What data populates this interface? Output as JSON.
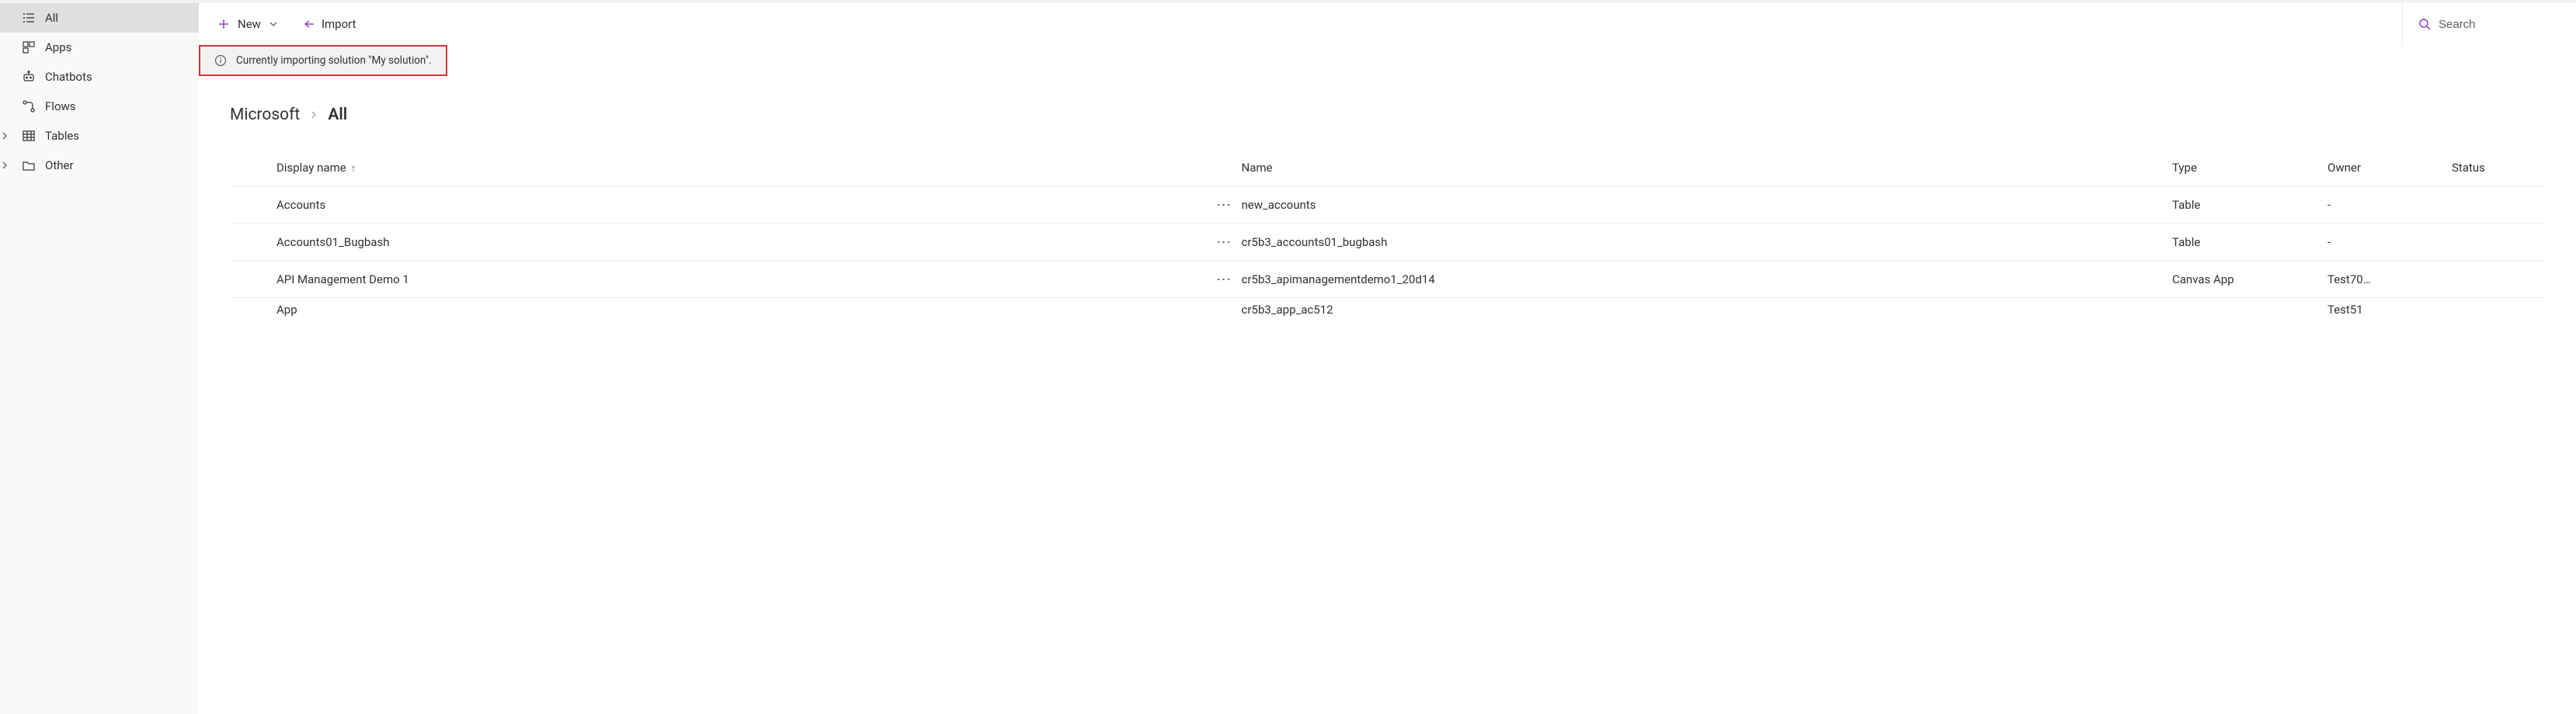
{
  "accent_color": "#5b5fc7",
  "sidebar": {
    "items": [
      {
        "label": "All",
        "icon": "list-icon",
        "selected": true,
        "expandable": false
      },
      {
        "label": "Apps",
        "icon": "apps-icon",
        "selected": false,
        "expandable": false
      },
      {
        "label": "Chatbots",
        "icon": "chatbot-icon",
        "selected": false,
        "expandable": false
      },
      {
        "label": "Flows",
        "icon": "flows-icon",
        "selected": false,
        "expandable": false
      },
      {
        "label": "Tables",
        "icon": "tables-icon",
        "selected": false,
        "expandable": true
      },
      {
        "label": "Other",
        "icon": "folder-icon",
        "selected": false,
        "expandable": true
      }
    ]
  },
  "toolbar": {
    "new_label": "New",
    "import_label": "Import"
  },
  "search": {
    "placeholder": "Search"
  },
  "banner": {
    "message": "Currently importing solution \"My solution\"."
  },
  "breadcrumb": {
    "root": "Microsoft",
    "current": "All"
  },
  "table": {
    "columns": {
      "display_name": "Display name",
      "name": "Name",
      "type": "Type",
      "owner": "Owner",
      "status": "Status"
    },
    "sort": {
      "column": "display_name",
      "dir": "asc",
      "indicator": "↑"
    },
    "rows": [
      {
        "display_name": "Accounts",
        "name": "new_accounts",
        "type": "Table",
        "owner": "-",
        "status": ""
      },
      {
        "display_name": "Accounts01_Bugbash",
        "name": "cr5b3_accounts01_bugbash",
        "type": "Table",
        "owner": "-",
        "status": ""
      },
      {
        "display_name": "API Management Demo 1",
        "name": "cr5b3_apimanagementdemo1_20d14",
        "type": "Canvas App",
        "owner": "Test70…",
        "status": ""
      }
    ],
    "cutoff_row": {
      "display_name": "App",
      "name": "cr5b3_app_ac512",
      "owner": "Test51"
    }
  }
}
